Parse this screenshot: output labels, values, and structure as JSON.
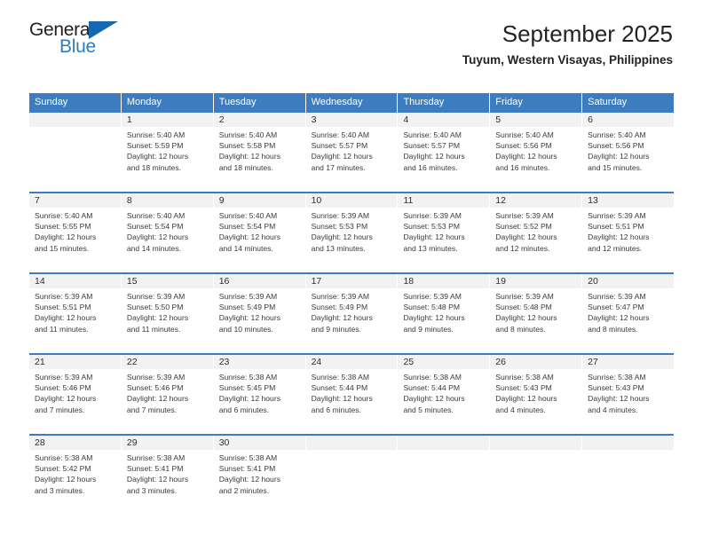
{
  "logo": {
    "word_one": "General",
    "word_two": "Blue",
    "triangle": "triangle-shape"
  },
  "header": {
    "title": "September 2025",
    "subtitle": "Tuyum, Western Visayas, Philippines"
  },
  "colors": {
    "header_blue": "#3d7dbf",
    "band_gray": "#f2f2f2",
    "logo_blue": "#2d7dc1",
    "triangle_blue": "#1368b0"
  },
  "calendar": {
    "weekday_headers": [
      "Sunday",
      "Monday",
      "Tuesday",
      "Wednesday",
      "Thursday",
      "Friday",
      "Saturday"
    ],
    "weeks": [
      [
        {
          "day": "",
          "empty": true,
          "sunrise": "",
          "sunset": "",
          "daylight_1": "",
          "daylight_2": ""
        },
        {
          "day": "1",
          "sunrise": "Sunrise: 5:40 AM",
          "sunset": "Sunset: 5:59 PM",
          "daylight_1": "Daylight: 12 hours",
          "daylight_2": "and 18 minutes."
        },
        {
          "day": "2",
          "sunrise": "Sunrise: 5:40 AM",
          "sunset": "Sunset: 5:58 PM",
          "daylight_1": "Daylight: 12 hours",
          "daylight_2": "and 18 minutes."
        },
        {
          "day": "3",
          "sunrise": "Sunrise: 5:40 AM",
          "sunset": "Sunset: 5:57 PM",
          "daylight_1": "Daylight: 12 hours",
          "daylight_2": "and 17 minutes."
        },
        {
          "day": "4",
          "sunrise": "Sunrise: 5:40 AM",
          "sunset": "Sunset: 5:57 PM",
          "daylight_1": "Daylight: 12 hours",
          "daylight_2": "and 16 minutes."
        },
        {
          "day": "5",
          "sunrise": "Sunrise: 5:40 AM",
          "sunset": "Sunset: 5:56 PM",
          "daylight_1": "Daylight: 12 hours",
          "daylight_2": "and 16 minutes."
        },
        {
          "day": "6",
          "sunrise": "Sunrise: 5:40 AM",
          "sunset": "Sunset: 5:56 PM",
          "daylight_1": "Daylight: 12 hours",
          "daylight_2": "and 15 minutes."
        }
      ],
      [
        {
          "day": "7",
          "sunrise": "Sunrise: 5:40 AM",
          "sunset": "Sunset: 5:55 PM",
          "daylight_1": "Daylight: 12 hours",
          "daylight_2": "and 15 minutes."
        },
        {
          "day": "8",
          "sunrise": "Sunrise: 5:40 AM",
          "sunset": "Sunset: 5:54 PM",
          "daylight_1": "Daylight: 12 hours",
          "daylight_2": "and 14 minutes."
        },
        {
          "day": "9",
          "sunrise": "Sunrise: 5:40 AM",
          "sunset": "Sunset: 5:54 PM",
          "daylight_1": "Daylight: 12 hours",
          "daylight_2": "and 14 minutes."
        },
        {
          "day": "10",
          "sunrise": "Sunrise: 5:39 AM",
          "sunset": "Sunset: 5:53 PM",
          "daylight_1": "Daylight: 12 hours",
          "daylight_2": "and 13 minutes."
        },
        {
          "day": "11",
          "sunrise": "Sunrise: 5:39 AM",
          "sunset": "Sunset: 5:53 PM",
          "daylight_1": "Daylight: 12 hours",
          "daylight_2": "and 13 minutes."
        },
        {
          "day": "12",
          "sunrise": "Sunrise: 5:39 AM",
          "sunset": "Sunset: 5:52 PM",
          "daylight_1": "Daylight: 12 hours",
          "daylight_2": "and 12 minutes."
        },
        {
          "day": "13",
          "sunrise": "Sunrise: 5:39 AM",
          "sunset": "Sunset: 5:51 PM",
          "daylight_1": "Daylight: 12 hours",
          "daylight_2": "and 12 minutes."
        }
      ],
      [
        {
          "day": "14",
          "sunrise": "Sunrise: 5:39 AM",
          "sunset": "Sunset: 5:51 PM",
          "daylight_1": "Daylight: 12 hours",
          "daylight_2": "and 11 minutes."
        },
        {
          "day": "15",
          "sunrise": "Sunrise: 5:39 AM",
          "sunset": "Sunset: 5:50 PM",
          "daylight_1": "Daylight: 12 hours",
          "daylight_2": "and 11 minutes."
        },
        {
          "day": "16",
          "sunrise": "Sunrise: 5:39 AM",
          "sunset": "Sunset: 5:49 PM",
          "daylight_1": "Daylight: 12 hours",
          "daylight_2": "and 10 minutes."
        },
        {
          "day": "17",
          "sunrise": "Sunrise: 5:39 AM",
          "sunset": "Sunset: 5:49 PM",
          "daylight_1": "Daylight: 12 hours",
          "daylight_2": "and 9 minutes."
        },
        {
          "day": "18",
          "sunrise": "Sunrise: 5:39 AM",
          "sunset": "Sunset: 5:48 PM",
          "daylight_1": "Daylight: 12 hours",
          "daylight_2": "and 9 minutes."
        },
        {
          "day": "19",
          "sunrise": "Sunrise: 5:39 AM",
          "sunset": "Sunset: 5:48 PM",
          "daylight_1": "Daylight: 12 hours",
          "daylight_2": "and 8 minutes."
        },
        {
          "day": "20",
          "sunrise": "Sunrise: 5:39 AM",
          "sunset": "Sunset: 5:47 PM",
          "daylight_1": "Daylight: 12 hours",
          "daylight_2": "and 8 minutes."
        }
      ],
      [
        {
          "day": "21",
          "sunrise": "Sunrise: 5:39 AM",
          "sunset": "Sunset: 5:46 PM",
          "daylight_1": "Daylight: 12 hours",
          "daylight_2": "and 7 minutes."
        },
        {
          "day": "22",
          "sunrise": "Sunrise: 5:39 AM",
          "sunset": "Sunset: 5:46 PM",
          "daylight_1": "Daylight: 12 hours",
          "daylight_2": "and 7 minutes."
        },
        {
          "day": "23",
          "sunrise": "Sunrise: 5:38 AM",
          "sunset": "Sunset: 5:45 PM",
          "daylight_1": "Daylight: 12 hours",
          "daylight_2": "and 6 minutes."
        },
        {
          "day": "24",
          "sunrise": "Sunrise: 5:38 AM",
          "sunset": "Sunset: 5:44 PM",
          "daylight_1": "Daylight: 12 hours",
          "daylight_2": "and 6 minutes."
        },
        {
          "day": "25",
          "sunrise": "Sunrise: 5:38 AM",
          "sunset": "Sunset: 5:44 PM",
          "daylight_1": "Daylight: 12 hours",
          "daylight_2": "and 5 minutes."
        },
        {
          "day": "26",
          "sunrise": "Sunrise: 5:38 AM",
          "sunset": "Sunset: 5:43 PM",
          "daylight_1": "Daylight: 12 hours",
          "daylight_2": "and 4 minutes."
        },
        {
          "day": "27",
          "sunrise": "Sunrise: 5:38 AM",
          "sunset": "Sunset: 5:43 PM",
          "daylight_1": "Daylight: 12 hours",
          "daylight_2": "and 4 minutes."
        }
      ],
      [
        {
          "day": "28",
          "sunrise": "Sunrise: 5:38 AM",
          "sunset": "Sunset: 5:42 PM",
          "daylight_1": "Daylight: 12 hours",
          "daylight_2": "and 3 minutes."
        },
        {
          "day": "29",
          "sunrise": "Sunrise: 5:38 AM",
          "sunset": "Sunset: 5:41 PM",
          "daylight_1": "Daylight: 12 hours",
          "daylight_2": "and 3 minutes."
        },
        {
          "day": "30",
          "sunrise": "Sunrise: 5:38 AM",
          "sunset": "Sunset: 5:41 PM",
          "daylight_1": "Daylight: 12 hours",
          "daylight_2": "and 2 minutes."
        },
        {
          "day": "",
          "empty": true,
          "sunrise": "",
          "sunset": "",
          "daylight_1": "",
          "daylight_2": ""
        },
        {
          "day": "",
          "empty": true,
          "sunrise": "",
          "sunset": "",
          "daylight_1": "",
          "daylight_2": ""
        },
        {
          "day": "",
          "empty": true,
          "sunrise": "",
          "sunset": "",
          "daylight_1": "",
          "daylight_2": ""
        },
        {
          "day": "",
          "empty": true,
          "sunrise": "",
          "sunset": "",
          "daylight_1": "",
          "daylight_2": ""
        }
      ]
    ]
  }
}
